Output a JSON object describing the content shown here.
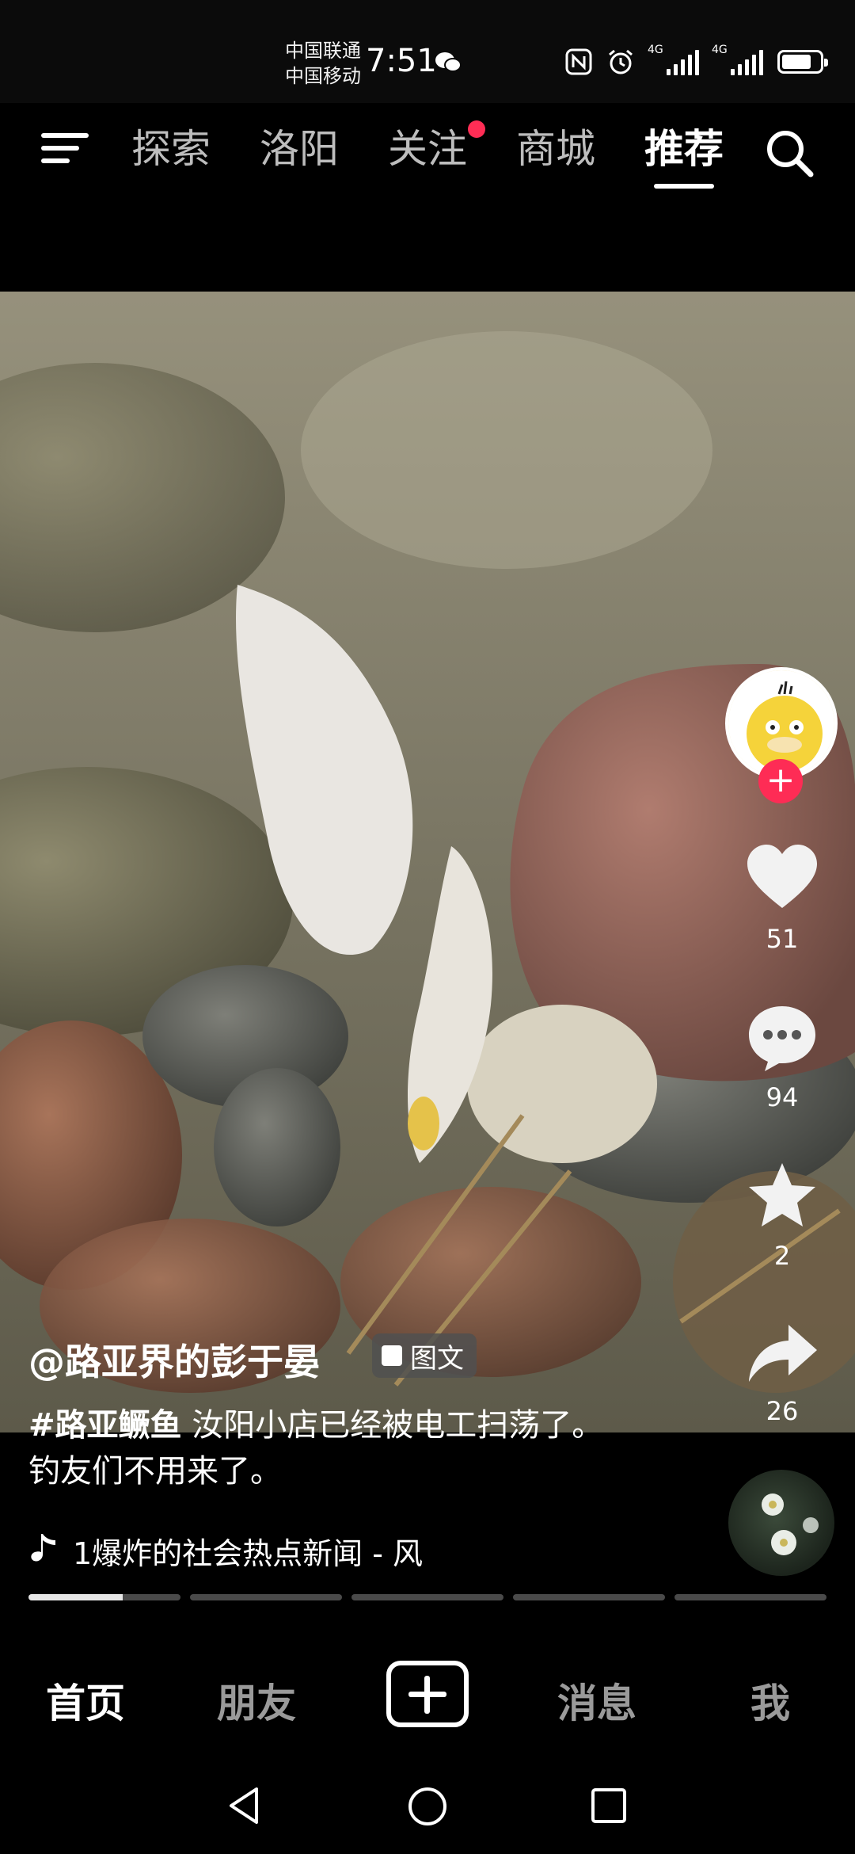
{
  "status_bar": {
    "carrier_1": "中国联通",
    "carrier_2": "中国移动",
    "time": "7:51",
    "network_1": "4G",
    "network_2": "4G",
    "icons": [
      "wechat-icon",
      "nfc-icon",
      "alarm-icon",
      "signal-icon",
      "signal-icon",
      "battery-icon"
    ]
  },
  "top_nav": {
    "tabs": [
      {
        "label": "探索",
        "active": false
      },
      {
        "label": "洛阳",
        "active": false
      },
      {
        "label": "关注",
        "active": false,
        "badge": true
      },
      {
        "label": "商城",
        "active": false
      },
      {
        "label": "推荐",
        "active": true
      }
    ],
    "menu_icon": "menu-icon",
    "search_icon": "search-icon"
  },
  "post": {
    "author": "@路亚界的彭于晏",
    "type_badge": "图文",
    "hashtag": "#路亚鳜鱼",
    "caption": " 汝阳小店已经被电工扫荡了。钓友们不用来了。",
    "music": "1爆炸的社会热点新闻 - 风",
    "progress_segments": 5,
    "progress_first_fill": 0.62
  },
  "actions": {
    "likes": "51",
    "comments": "94",
    "favorites": "2",
    "shares": "26"
  },
  "bottom_nav": {
    "items": [
      {
        "label": "首页",
        "active": true
      },
      {
        "label": "朋友",
        "active": false
      },
      {
        "label": "消息",
        "active": false
      },
      {
        "label": "我",
        "active": false
      }
    ]
  },
  "colors": {
    "accent": "#fe2c55",
    "background": "#000000"
  }
}
